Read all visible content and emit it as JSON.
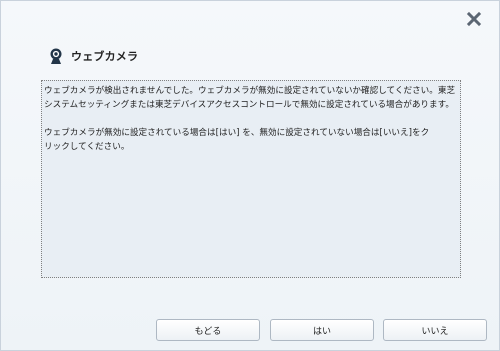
{
  "window": {
    "title": "ウェブカメラ",
    "title_icon": "webcam-icon",
    "close_icon": "close-icon"
  },
  "message": {
    "line1": "ウェブカメラが検出されませんでした。ウェブカメラが無効に設定されていないか確認してください。東芝",
    "line2": "システムセッティングまたは東芝デバイスアクセスコントロールで無効に設定されている場合があります。",
    "line3": "ウェブカメラが無効に設定されている場合は[はい] を、無効に設定されていない場合は[いいえ]をク",
    "line4": "リックしてください。"
  },
  "buttons": {
    "back": "もどる",
    "yes": "はい",
    "no": "いいえ"
  },
  "colors": {
    "window_background": "#eef3f7",
    "message_background": "#e8eef4",
    "button_border": "#aeb8c3",
    "icon_dark": "#223548"
  }
}
